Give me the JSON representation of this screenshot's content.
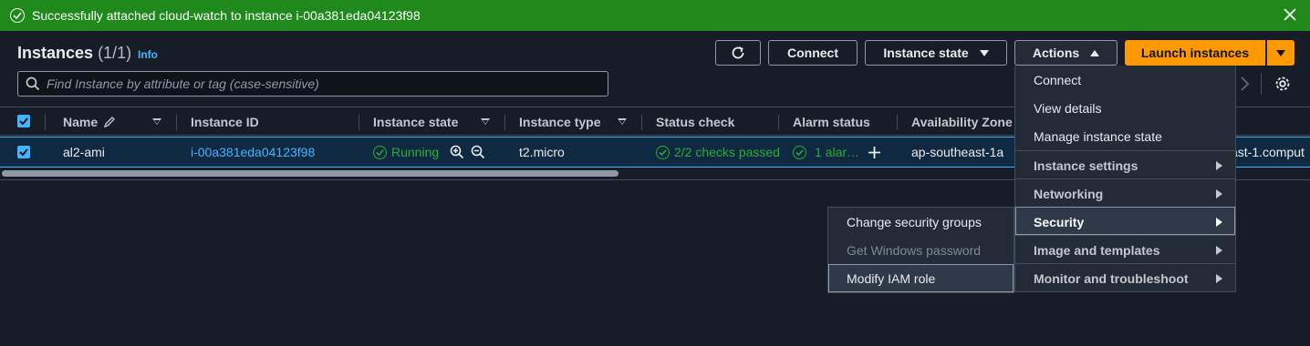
{
  "flash": {
    "message": "Successfully attached cloud-watch to instance i-00a381eda04123f98",
    "type": "success",
    "color": "#1f8a1b"
  },
  "header": {
    "title": "Instances",
    "count": "(1/1)",
    "info": "Info"
  },
  "toolbar": {
    "connect": "Connect",
    "instance_state": "Instance state",
    "actions": "Actions",
    "launch": "Launch instances"
  },
  "search": {
    "placeholder": "Find Instance by attribute or tag (case-sensitive)",
    "value": ""
  },
  "table": {
    "columns": [
      "Name",
      "Instance ID",
      "Instance state",
      "Instance type",
      "Status check",
      "Alarm status",
      "Availability Zone"
    ],
    "rows": [
      {
        "selected": true,
        "name": "al2-ami",
        "instance_id": "i-00a381eda04123f98",
        "state": "Running",
        "type": "t2.micro",
        "status_check": "2/2 checks passed",
        "alarm": "1 alar…",
        "zone": "ap-southeast-1a",
        "dns_partial": "ast-1.comput"
      }
    ]
  },
  "actions_menu": {
    "items": [
      {
        "label": "Connect",
        "kind": "item"
      },
      {
        "label": "View details",
        "kind": "item"
      },
      {
        "label": "Manage instance state",
        "kind": "item"
      },
      {
        "label": "Instance settings",
        "kind": "group"
      },
      {
        "label": "Networking",
        "kind": "group"
      },
      {
        "label": "Security",
        "kind": "group",
        "active": true
      },
      {
        "label": "Image and templates",
        "kind": "group"
      },
      {
        "label": "Monitor and troubleshoot",
        "kind": "group"
      }
    ]
  },
  "security_submenu": {
    "items": [
      {
        "label": "Change security groups",
        "disabled": false
      },
      {
        "label": "Get Windows password",
        "disabled": true
      },
      {
        "label": "Modify IAM role",
        "disabled": false,
        "active": true
      }
    ]
  },
  "colors": {
    "background": "#161d26",
    "accent": "#42b4ff",
    "primary_button": "#ff9900",
    "success": "#29ad32"
  }
}
